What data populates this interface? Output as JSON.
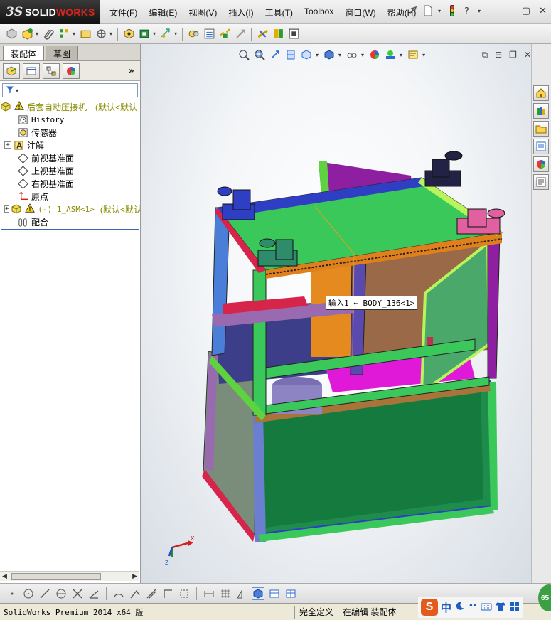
{
  "app": {
    "logo_ds": "3S",
    "logo_brand_a": "SOLID",
    "logo_brand_b": "WORKS"
  },
  "menu": [
    "文件(F)",
    "编辑(E)",
    "视图(V)",
    "插入(I)",
    "工具(T)",
    "Toolbox",
    "窗口(W)",
    "帮助(H)"
  ],
  "panel_tabs": {
    "assembly": "装配体",
    "sketch": "草图"
  },
  "tree": {
    "root": {
      "label": "后套自动压接机",
      "config": "(默认<默认"
    },
    "history": "History",
    "sensors": "传感器",
    "annotations": "注解",
    "front_plane": "前视基准面",
    "top_plane": "上视基准面",
    "right_plane": "右视基准面",
    "origin": "原点",
    "subasm": {
      "label": "(-) 1_ASM<1>",
      "config": "(默认<默认"
    },
    "mates": "配合"
  },
  "viewport": {
    "callout": "输入1 ← BODY_136<1>",
    "triad_x": "X",
    "triad_z": "Z"
  },
  "statusbar": {
    "app": "SolidWorks Premium 2014 x64 版",
    "definition": "完全定义",
    "mode": "在编辑 装配体"
  },
  "ime": {
    "s": "S",
    "lang": "中"
  },
  "badge": "65",
  "colors": {
    "frame_blue": "#2e3fc4",
    "frame_green": "#5fd33f",
    "panel_green": "#1e8c4a",
    "magenta": "#d61ad6",
    "orange": "#d9821c",
    "accent_red": "#d9231d"
  }
}
